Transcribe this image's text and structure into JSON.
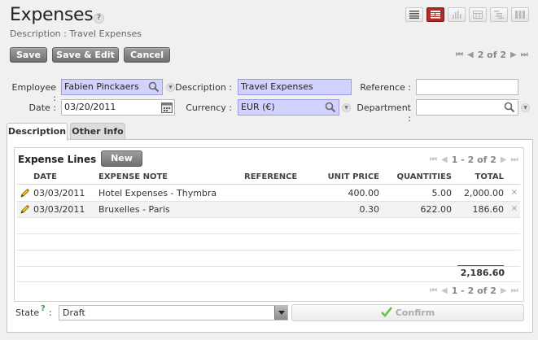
{
  "header": {
    "title": "Expenses",
    "help": "?",
    "subtitle": "Description : Travel Expenses",
    "views": [
      "list-view-icon",
      "form-view-icon",
      "graph-view-icon",
      "calendar-view-icon",
      "gantt-view-icon",
      "kanban-view-icon"
    ],
    "active_view": "form-view-icon"
  },
  "toolbar": {
    "save": "Save",
    "save_edit": "Save & Edit",
    "cancel": "Cancel",
    "pager": "2 of 2"
  },
  "form": {
    "employee_label": "Employee :",
    "employee_value": "Fabien Pinckaers",
    "description_label": "Description :",
    "description_value": "Travel Expenses",
    "reference_label": "Reference :",
    "reference_value": "",
    "date_label": "Date :",
    "date_value": "03/20/2011",
    "currency_label": "Currency :",
    "currency_value": "EUR (€)",
    "department_label": "Department :",
    "department_value": ""
  },
  "tabs": [
    "Description",
    "Other Info"
  ],
  "lines": {
    "title": "Expense Lines",
    "new_label": "New",
    "pager": "1 - 2 of 2",
    "columns": [
      "DATE",
      "EXPENSE NOTE",
      "REFERENCE",
      "UNIT PRICE",
      "QUANTITIES",
      "TOTAL"
    ],
    "rows": [
      {
        "date": "03/03/2011",
        "note": "Hotel Expenses - Thymbra",
        "reference": "",
        "unit_price": "400.00",
        "quantity": "5.00",
        "total": "2,000.00"
      },
      {
        "date": "03/03/2011",
        "note": "Bruxelles - Paris",
        "reference": "",
        "unit_price": "0.30",
        "quantity": "622.00",
        "total": "186.60"
      }
    ],
    "grand_total": "2,186.60",
    "delete_glyph": "×"
  },
  "state": {
    "label": "State",
    "help": "?",
    "colon": ":",
    "value": "Draft",
    "confirm_label": "Confirm"
  },
  "colors": {
    "required_field": "#d2d2ff",
    "active_view": "#b22b2b",
    "button": "#7f7f7f"
  }
}
